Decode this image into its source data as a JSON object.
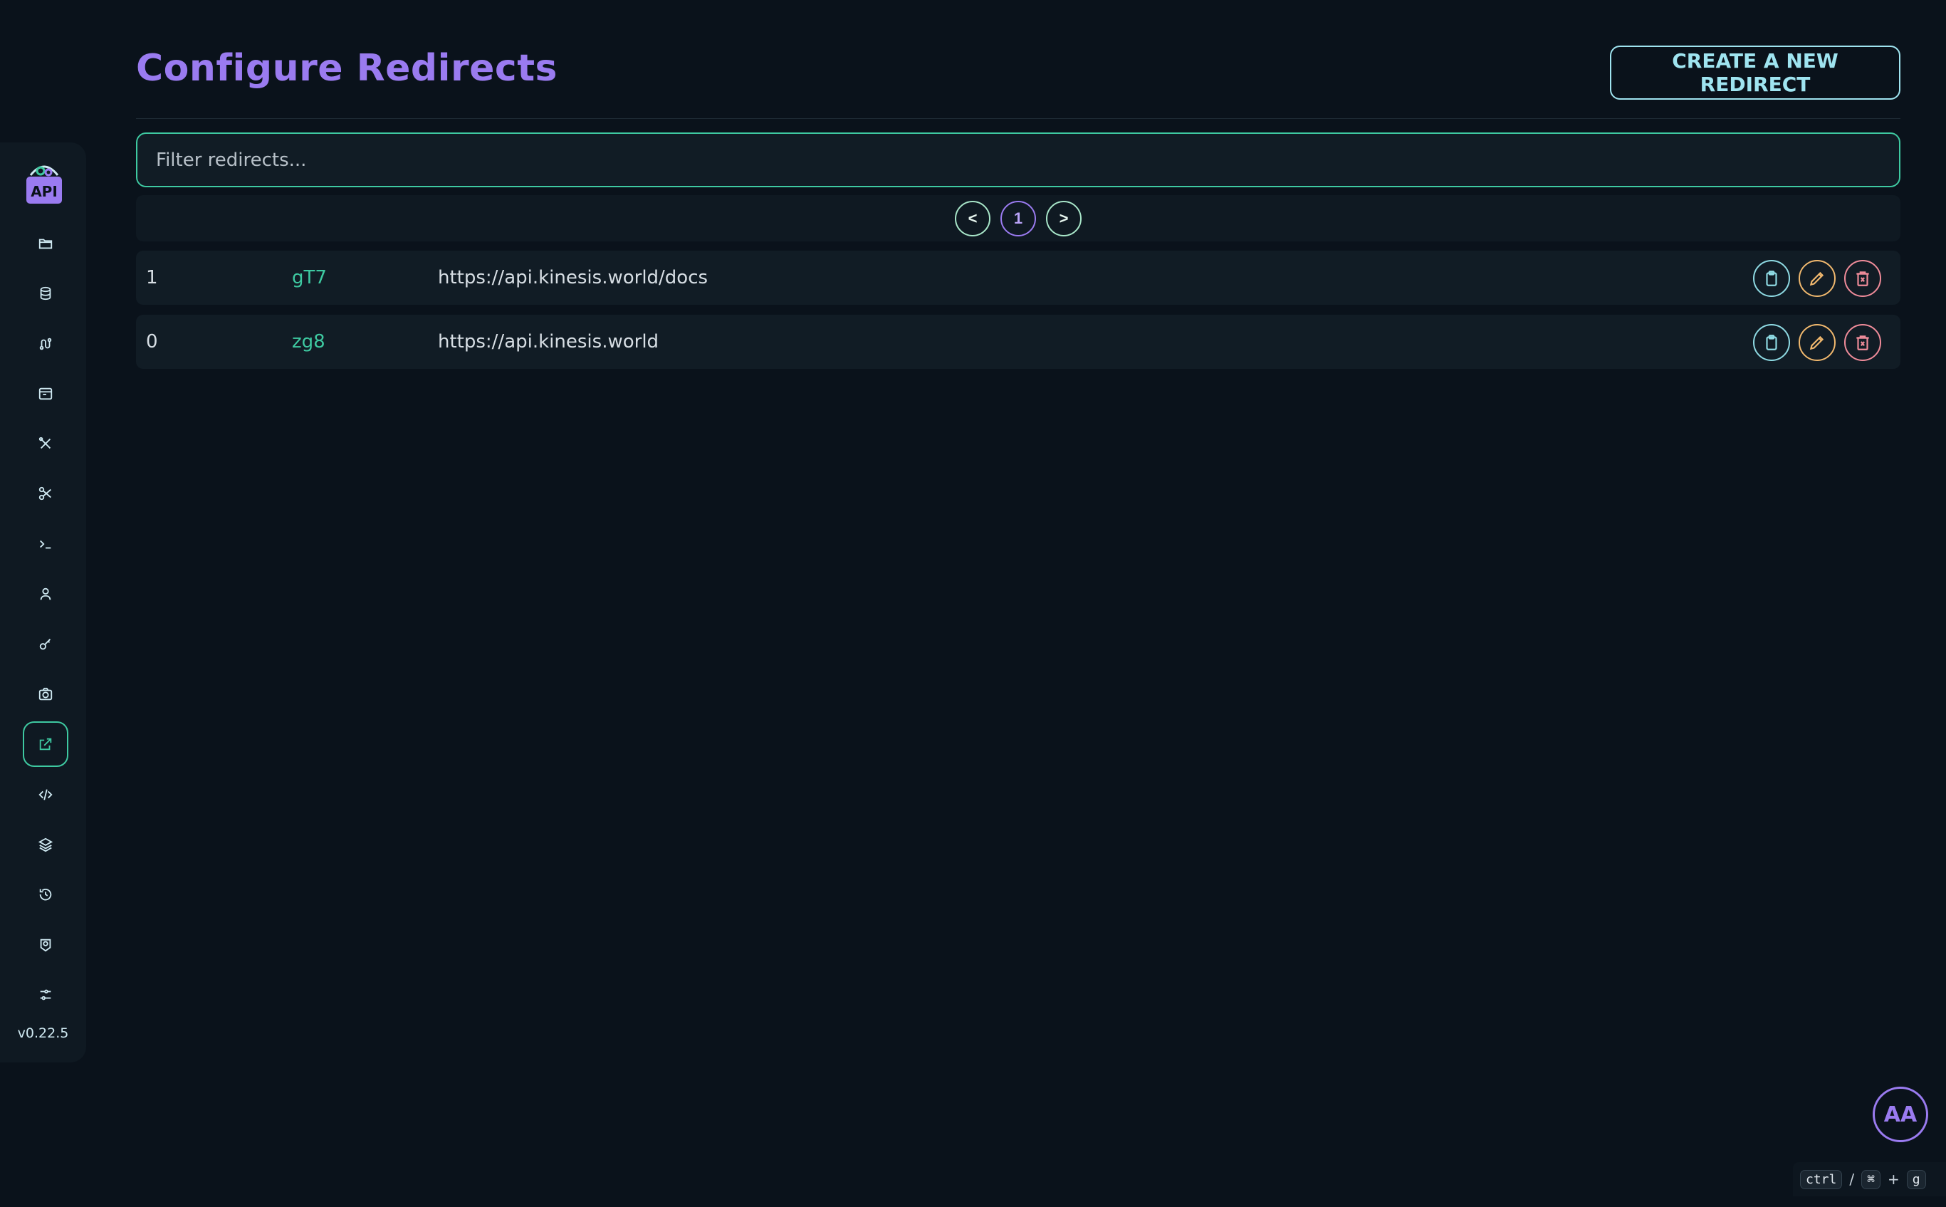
{
  "app": {
    "version": "v0.22.5",
    "logo_text": "API"
  },
  "sidebar": {
    "items": [
      {
        "name": "folder-icon",
        "active": false
      },
      {
        "name": "database-icon",
        "active": false
      },
      {
        "name": "route-icon",
        "active": false
      },
      {
        "name": "browser-window-icon",
        "active": false
      },
      {
        "name": "tools-icon",
        "active": false
      },
      {
        "name": "scissors-icon",
        "active": false
      },
      {
        "name": "terminal-icon",
        "active": false
      },
      {
        "name": "user-icon",
        "active": false
      },
      {
        "name": "key-icon",
        "active": false
      },
      {
        "name": "camera-icon",
        "active": false
      },
      {
        "name": "external-link-icon",
        "active": true
      },
      {
        "name": "code-icon",
        "active": false
      },
      {
        "name": "layers-icon",
        "active": false
      },
      {
        "name": "history-icon",
        "active": false
      },
      {
        "name": "user-badge-icon",
        "active": false
      },
      {
        "name": "settings-icon",
        "active": false
      }
    ]
  },
  "header": {
    "title": "Configure Redirects",
    "create_label": "CREATE A NEW REDIRECT"
  },
  "filter": {
    "placeholder": "Filter redirects...",
    "value": ""
  },
  "pagination": {
    "prev_label": "<",
    "current_page": "1",
    "next_label": ">"
  },
  "redirects": [
    {
      "id": "1",
      "code": "gT7",
      "url": "https://api.kinesis.world/docs"
    },
    {
      "id": "0",
      "code": "zg8",
      "url": "https://api.kinesis.world"
    }
  ],
  "user": {
    "avatar_initials": "AA"
  },
  "shortcut": {
    "key1": "ctrl",
    "separator": "/",
    "key2": "⌘",
    "plus": "+",
    "key3": "g"
  },
  "colors": {
    "background": "#0a121b",
    "accent_purple": "#9a7bf0",
    "accent_green": "#3ec9a1",
    "copy": "#8fdbe4",
    "edit": "#f0b86e",
    "delete": "#f08c9a"
  }
}
